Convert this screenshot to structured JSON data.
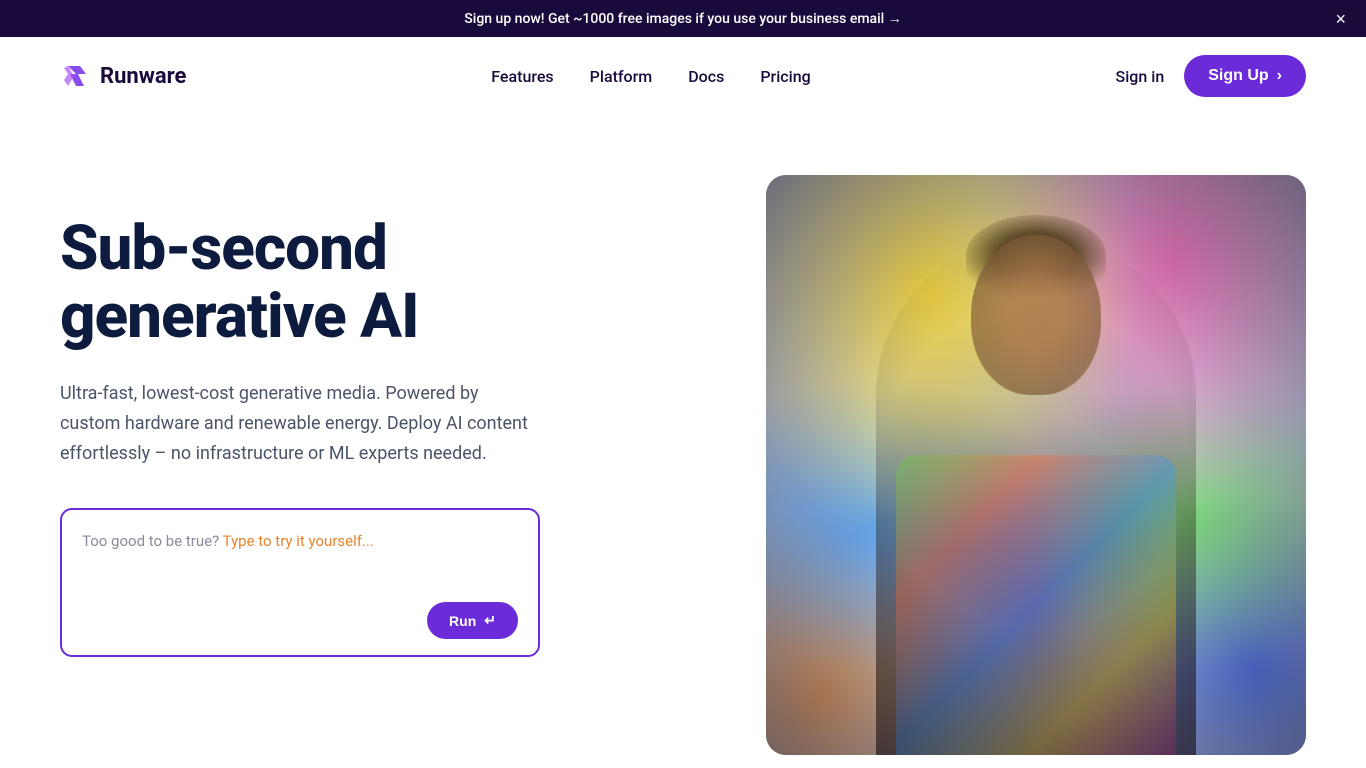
{
  "banner": {
    "text": "Sign up now! Get ~1000 free images if you use your business email →",
    "close_label": "×"
  },
  "navbar": {
    "logo_text": "Runware",
    "nav_links": [
      {
        "label": "Features",
        "id": "features"
      },
      {
        "label": "Platform",
        "id": "platform"
      },
      {
        "label": "Docs",
        "id": "docs"
      },
      {
        "label": "Pricing",
        "id": "pricing"
      }
    ],
    "sign_in_label": "Sign in",
    "sign_up_label": "Sign Up",
    "sign_up_arrow": "›"
  },
  "hero": {
    "title": "Sub-second generative AI",
    "subtitle": "Ultra-fast, lowest-cost generative media. Powered by custom hardware and renewable energy. Deploy AI content effortlessly – no infrastructure or ML experts needed.",
    "prompt": {
      "placeholder": "Too good to be true? Type to try it yourself...",
      "run_label": "Run",
      "run_icon": "↵"
    }
  },
  "colors": {
    "banner_bg": "#1a0a3c",
    "accent_purple": "#6c2bd9",
    "hero_title": "#0d1b3e",
    "hero_subtitle": "#4a5568",
    "prompt_border": "#6c2bd9"
  }
}
